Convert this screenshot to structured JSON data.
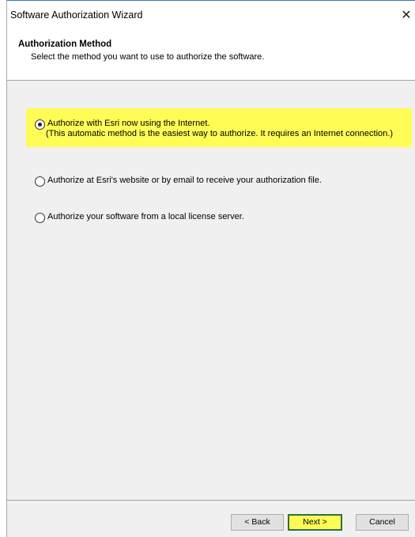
{
  "window": {
    "title": "Software Authorization Wizard",
    "close_glyph": "✕"
  },
  "header": {
    "title": "Authorization Method",
    "subtitle": "Select the method you want to use to authorize the software."
  },
  "options": [
    {
      "label": "Authorize with Esri now using the Internet.",
      "description": "(This automatic method is the easiest way to authorize. It requires an Internet connection.)",
      "selected": true,
      "highlighted": true
    },
    {
      "label": "Authorize at Esri's website or by email to receive your authorization file.",
      "selected": false
    },
    {
      "label": "Authorize your software from a local license server.",
      "selected": false
    }
  ],
  "buttons": {
    "back": "< Back",
    "next": "Next >",
    "cancel": "Cancel"
  },
  "colors": {
    "highlight": "#fffd55",
    "dialog_bg": "#f0f0f0",
    "next_border": "#2f6f3f"
  }
}
